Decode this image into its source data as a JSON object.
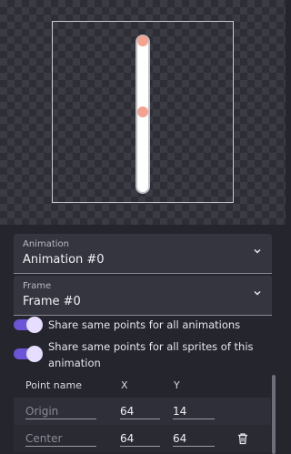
{
  "preview": {
    "sprite": "white-vertical-bar",
    "point_color": "#f3a28f"
  },
  "animation_select": {
    "label": "Animation",
    "value": "Animation #0"
  },
  "frame_select": {
    "label": "Frame",
    "value": "Frame #0"
  },
  "toggles": [
    {
      "label": "Share same points for all animations",
      "on": true
    },
    {
      "label": "Share same points for all sprites of this animation",
      "on": true
    }
  ],
  "points_table": {
    "headers": {
      "name": "Point name",
      "x": "X",
      "y": "Y"
    },
    "rows": [
      {
        "name": "Origin",
        "x": "64",
        "y": "14"
      },
      {
        "name": "Center",
        "x": "64",
        "y": "64"
      }
    ]
  },
  "colors": {
    "accent": "#6b55d6",
    "knob": "#e6ddff",
    "background": "#25252e"
  }
}
